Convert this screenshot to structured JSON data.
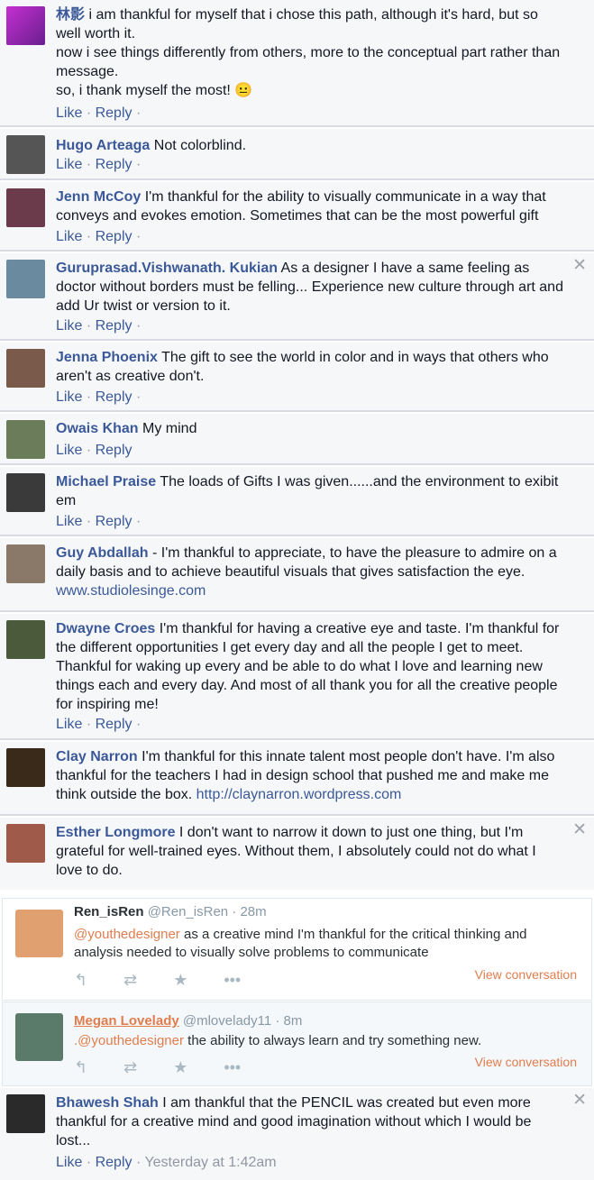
{
  "comments": [
    {
      "name": "林影",
      "text": " i am thankful for myself that i chose this path, although it's hard, but so well worth it.",
      "text2": "now i see things differently from others, more to the conceptual part rather than message.",
      "text3": "so, i thank myself the most! 😐",
      "like": "Like",
      "reply": "Reply",
      "sep": "·"
    },
    {
      "name": "Hugo Arteaga",
      "text": " Not colorblind.",
      "like": "Like",
      "reply": "Reply",
      "sep": "·"
    },
    {
      "name": "Jenn McCoy",
      "text": " I'm thankful for the ability to visually communicate in a way that conveys and evokes emotion. Sometimes that can be the most powerful gift",
      "like": "Like",
      "reply": "Reply",
      "sep": "·"
    },
    {
      "name": "Guruprasad.Vishwanath. Kukian",
      "text": " As a designer I have a same feeling as doctor without borders must be felling... Experience new culture through art and add Ur twist or version to it.",
      "like": "Like",
      "reply": "Reply",
      "sep": "·",
      "close": "✕"
    },
    {
      "name": "Jenna Phoenix",
      "text": " The gift to see the world in color and in ways that others who aren't as creative don't.",
      "like": "Like",
      "reply": "Reply",
      "sep": "·"
    },
    {
      "name": "Owais Khan",
      "text": " My mind",
      "like": "Like",
      "reply": "Reply",
      "sep": "·"
    },
    {
      "name": "Michael Praise",
      "text": " The loads of Gifts I was given......and the environment to exibit em",
      "like": "Like",
      "reply": "Reply",
      "sep": "·"
    },
    {
      "name": "Guy Abdallah",
      "text": " - I'm thankful to appreciate, to have the pleasure to admire on a daily basis and to achieve beautiful visuals that gives satisfaction the eye.",
      "link": "www.studiolesinge.com"
    },
    {
      "name": "Dwayne Croes",
      "text": " I'm thankful for having a creative eye and taste. I'm thankful for the different opportunities I get every day and all the people I get to meet. Thankful for waking up every and be able to do what I love and learning new things each and every day. And most of all thank you for all the creative people for inspiring me!",
      "like": "Like",
      "reply": "Reply",
      "sep": "·"
    },
    {
      "name": "Clay Narron",
      "text": " I'm thankful for this innate talent most people don't have. I'm also thankful for the teachers I had in design school that pushed me and make me think outside the box. ",
      "link": "http://claynarron.wordpress.com"
    },
    {
      "name": "Esther Longmore",
      "text": " I don't want to narrow it down to just one thing, but I'm grateful for well-trained eyes. Without them, I absolutely could not do what I love to do.",
      "close": "✕"
    }
  ],
  "tweets": [
    {
      "name": "Ren_isRen",
      "handle": "@Ren_isRen · 28m",
      "mention": "@youthedesigner",
      "text": " as a creative mind I'm thankful for the critical thinking and analysis needed to visually solve problems to communicate",
      "view": "View conversation"
    },
    {
      "name": "Megan Lovelady",
      "handle": "@mlovelady11 · 8m",
      "mention": ".@youthedesigner",
      "text": " the ability to always learn and try something new.",
      "view": "View conversation"
    }
  ],
  "last": {
    "name": "Bhawesh Shah",
    "text": " I am thankful that the PENCIL was created but even more thankful for a creative mind and good imagination without which I would be lost...",
    "like": "Like",
    "reply": "Reply",
    "sep": "·",
    "time": "Yesterday at 1:42am",
    "close": "✕"
  },
  "tweet_icons": [
    "reply-icon",
    "retweet-icon",
    "favorite-icon",
    "more-icon"
  ],
  "colors": {
    "fb_link": "#3b5998",
    "tw_accent": "#e07d4e",
    "bg": "#f6f7f9"
  }
}
